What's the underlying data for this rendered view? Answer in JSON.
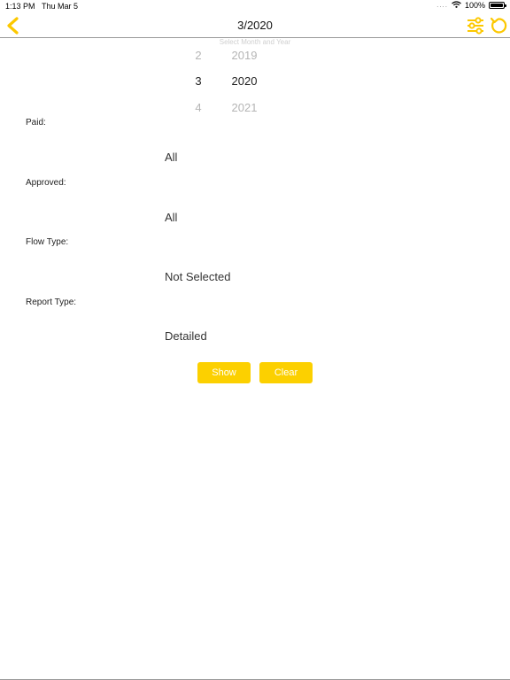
{
  "status_bar": {
    "time": "1:13 PM",
    "date": "Thu Mar 5",
    "signal_dots": "....",
    "battery": "100%",
    "battery_level": 1.0
  },
  "nav": {
    "title": "3/2020",
    "back_icon": "chevron-left-icon",
    "filter_icon": "sliders-icon",
    "refresh_icon": "refresh-icon",
    "accent_color": "#fcc800"
  },
  "picker": {
    "caption": "Select Month and Year",
    "rows": [
      {
        "month": "2",
        "year": "2019"
      },
      {
        "month": "3",
        "year": "2020"
      },
      {
        "month": "4",
        "year": "2021"
      }
    ]
  },
  "filters": {
    "paid": {
      "label": "Paid:",
      "value": "All"
    },
    "approved": {
      "label": "Approved:",
      "value": "All"
    },
    "flow_type": {
      "label": "Flow Type:",
      "value": "Not Selected"
    },
    "report_type": {
      "label": "Report Type:",
      "value": "Detailed"
    }
  },
  "actions": {
    "show_label": "Show",
    "clear_label": "Clear",
    "button_color": "#fcd000"
  }
}
